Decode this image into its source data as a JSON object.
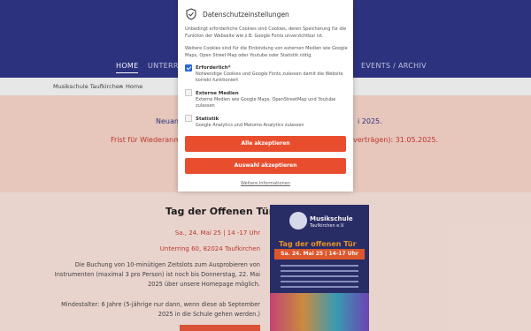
{
  "nav": {
    "items": [
      {
        "label": "HOME",
        "active": true
      },
      {
        "label": "UNTERRI",
        "active": false
      },
      {
        "label": "EVENTS / ARCHIV",
        "active": false
      }
    ]
  },
  "breadcrumb": {
    "root": "Musikschule Taufkirchen",
    "separator": "»",
    "current": "Home"
  },
  "notices": {
    "line1_left": "Neuan",
    "line1_right": "i 2025.",
    "line2_left": "Frist für Wiederanme",
    "line2_right": "verträgen): 31.05.2025."
  },
  "event": {
    "title": "Tag der Offenen Tür",
    "date": "Sa., 24. Mai 25 | 14 -17 Uhr",
    "place": "Unterring 60, 82024 Taufkirchen",
    "body1": "Die Buchung von 10-minütigen Zeitslots zum Ausprobieren von Instrumenten (maximal 3 pro Person) ist noch bis Donnerstag, 22. Mai 2025 über unsere Homepage möglich.",
    "body2": "Mindestalter: 6 Jahre (5-jährige nur dann, wenn diese ab September 2025 in die Schule gehen werden.)"
  },
  "poster": {
    "school": "Musikschule",
    "school_sub": "Taufkirchen e.V.",
    "title": "Tag der offenen Tür",
    "date": "Sa. 24. Mai 25 | 14-17 Uhr"
  },
  "cookie": {
    "title": "Datenschutzeinstellungen",
    "intro": "Unbedingt erforderliche Cookies sind Cookies, deren Speicherung für die Funktion der Webseite wie z.B. Google Fonts unverzichtbar ist.",
    "intro2": "Weitere Cookies sind für die Einbindung von externen Medien wie Google Maps, Open Street Map oder Youtube oder Statistik nötig.",
    "options": [
      {
        "title": "Erforderlich*",
        "desc": "Notwendige Cookies und Google Fonts zulassen damit die Website korrekt funktioniert",
        "checked": true
      },
      {
        "title": "Externe Medien",
        "desc": "Externe Medien wie Google Maps, OpenStreetMap und Youtube zulassen",
        "checked": false
      },
      {
        "title": "Statistik",
        "desc": "Google Analytics und Matomo Analytics zulassen",
        "checked": false
      }
    ],
    "accept_all": "Alle akzeptieren",
    "accept_selection": "Auswahl akzeptieren",
    "more_info": "Weitere Informationen"
  },
  "colors": {
    "header": "#2e3584",
    "accent": "#e84e2e",
    "notice_red": "#c43a2a",
    "check_blue": "#2b66d9"
  }
}
